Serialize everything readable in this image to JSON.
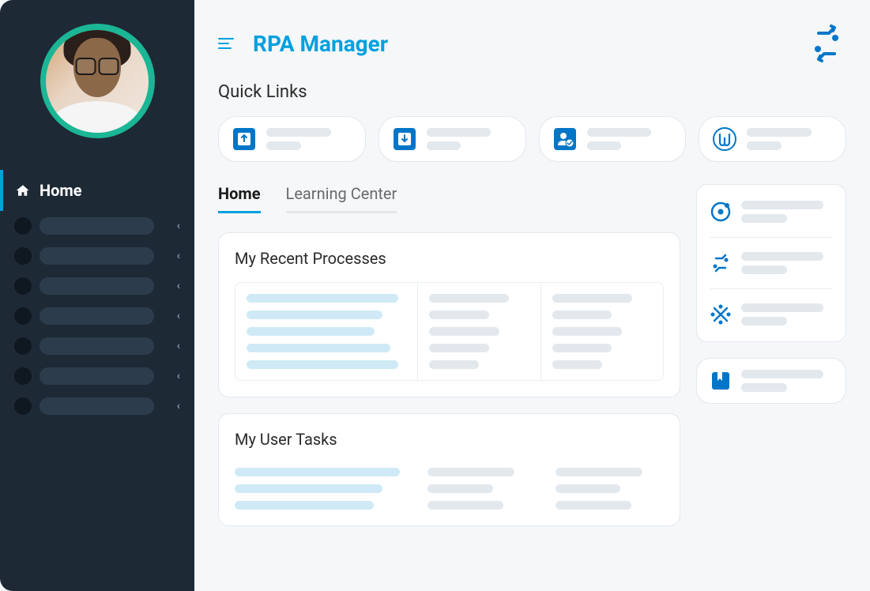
{
  "app": {
    "title": "RPA Manager"
  },
  "sidebar": {
    "home_label": "Home"
  },
  "sections": {
    "quick_links": "Quick Links",
    "recent_processes": "My Recent Processes",
    "user_tasks": "My User Tasks"
  },
  "tabs": {
    "home": "Home",
    "learning_center": "Learning Center"
  }
}
